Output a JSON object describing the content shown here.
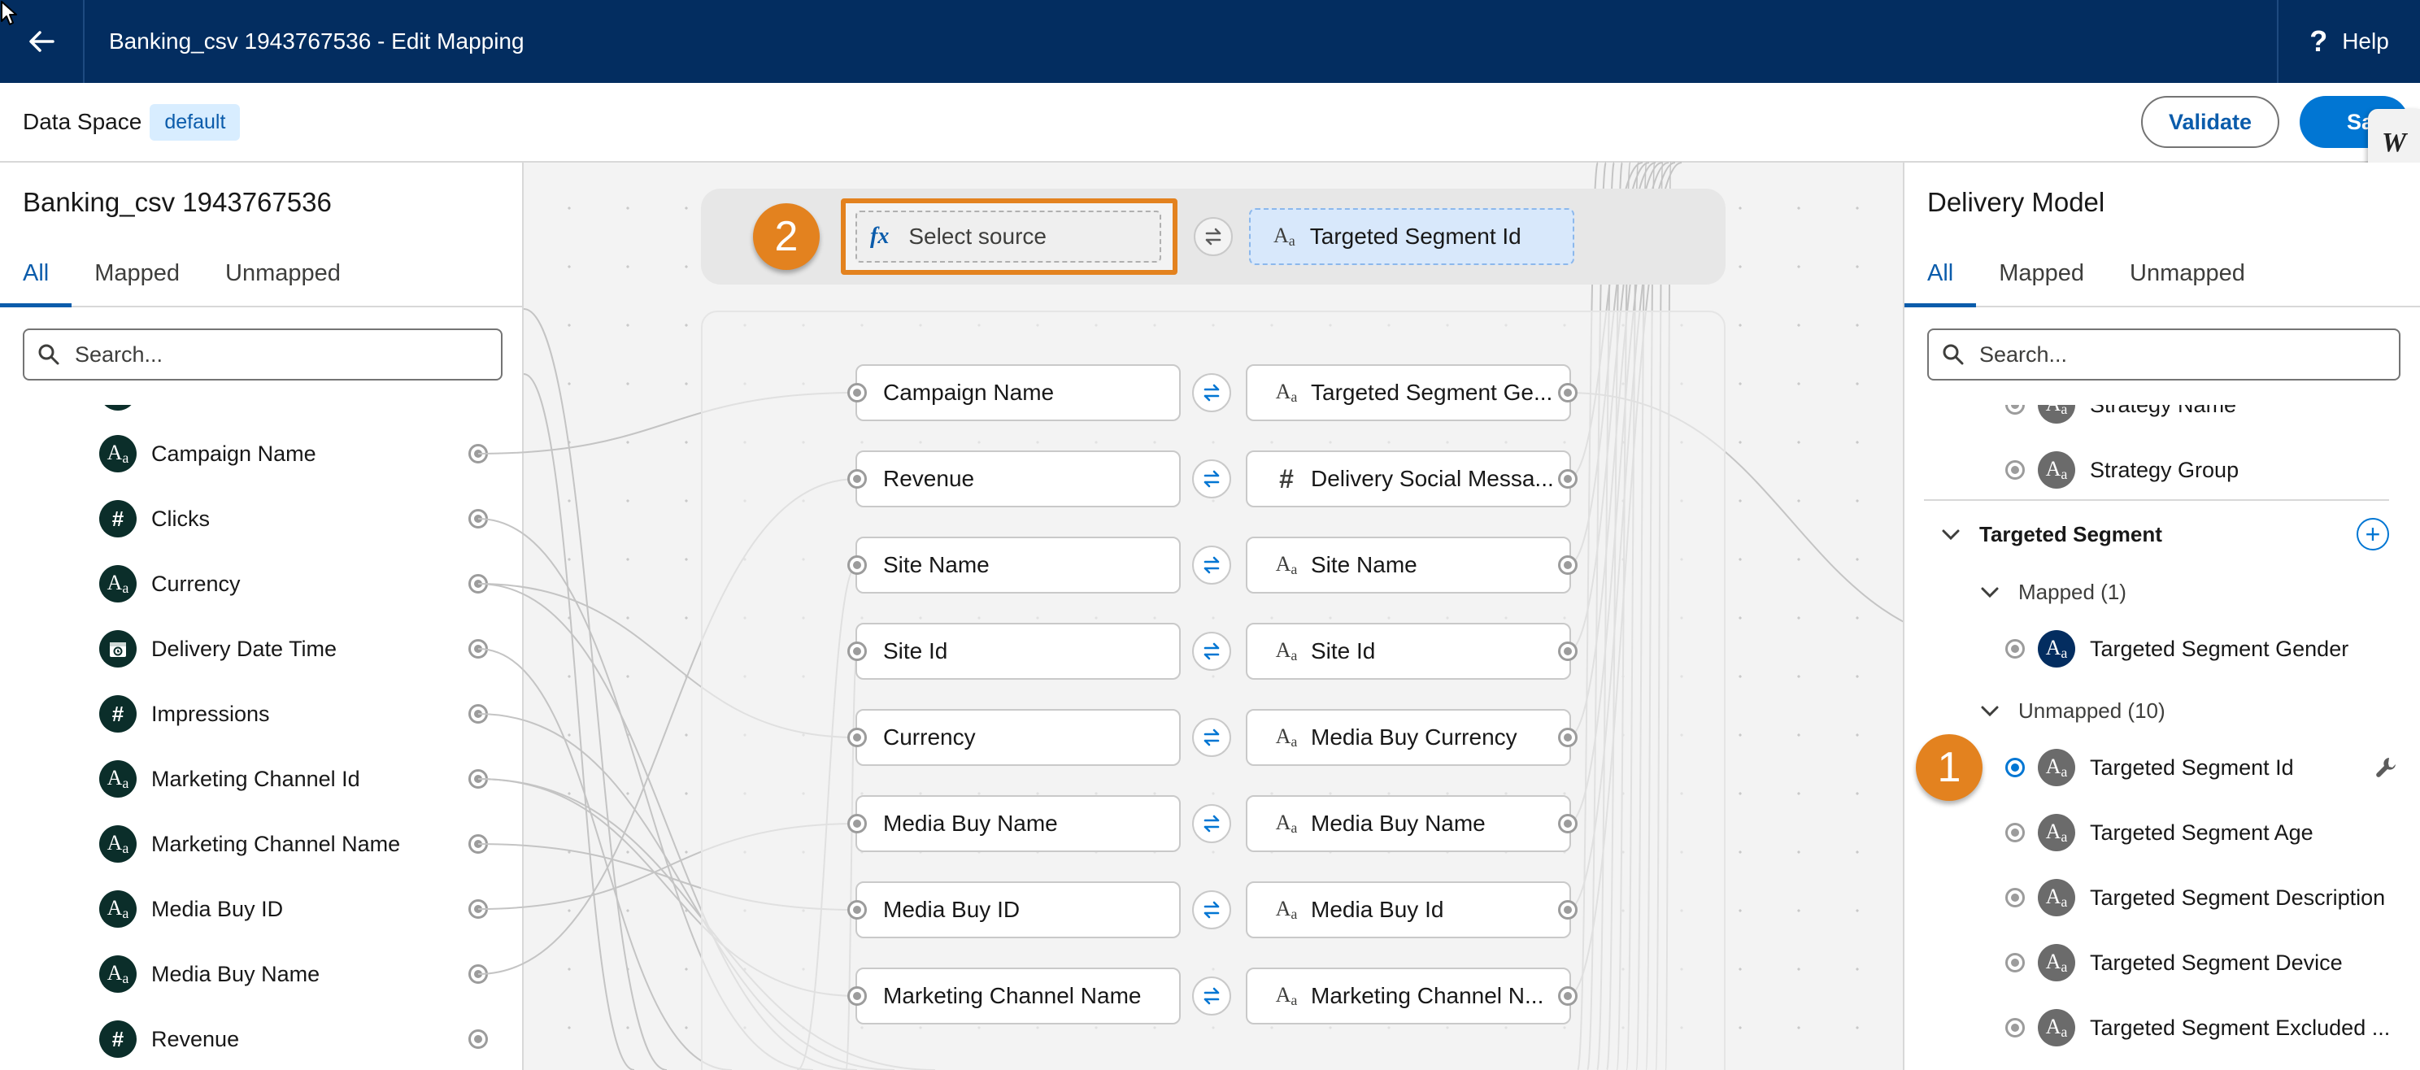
{
  "header": {
    "title": "Banking_csv 1943767536 - Edit Mapping",
    "help_label": "Help"
  },
  "subheader": {
    "data_space_label": "Data Space",
    "data_space_value": "default",
    "validate_label": "Validate",
    "save_label": "Save",
    "widget_glyph": "W"
  },
  "left_panel": {
    "title": "Banking_csv 1943767536",
    "tabs": [
      "All",
      "Mapped",
      "Unmapped"
    ],
    "search_placeholder": "Search...",
    "fields": [
      {
        "label": "Campaign Name",
        "type": "text"
      },
      {
        "label": "Clicks",
        "type": "number"
      },
      {
        "label": "Currency",
        "type": "text"
      },
      {
        "label": "Delivery Date Time",
        "type": "datetime"
      },
      {
        "label": "Impressions",
        "type": "number"
      },
      {
        "label": "Marketing Channel Id",
        "type": "text"
      },
      {
        "label": "Marketing Channel Name",
        "type": "text"
      },
      {
        "label": "Media Buy ID",
        "type": "text"
      },
      {
        "label": "Media Buy Name",
        "type": "text"
      },
      {
        "label": "Revenue",
        "type": "number"
      }
    ]
  },
  "canvas": {
    "select_source_placeholder": "Select source",
    "fx_glyph": "fx",
    "selected_target": "Targeted Segment Id",
    "mappings": [
      {
        "source": "Campaign Name",
        "target": "Targeted Segment Ge...",
        "target_type": "text"
      },
      {
        "source": "Revenue",
        "target": "Delivery Social Messa...",
        "target_type": "number"
      },
      {
        "source": "Site Name",
        "target": "Site Name",
        "target_type": "text"
      },
      {
        "source": "Site Id",
        "target": "Site Id",
        "target_type": "text"
      },
      {
        "source": "Currency",
        "target": "Media Buy Currency",
        "target_type": "text"
      },
      {
        "source": "Media Buy Name",
        "target": "Media Buy Name",
        "target_type": "text"
      },
      {
        "source": "Media Buy ID",
        "target": "Media Buy Id",
        "target_type": "text"
      },
      {
        "source": "Marketing Channel Name",
        "target": "Marketing Channel N...",
        "target_type": "text"
      }
    ]
  },
  "right_panel": {
    "title": "Delivery Model",
    "tabs": [
      "All",
      "Mapped",
      "Unmapped"
    ],
    "search_placeholder": "Search...",
    "pre_fields": [
      "Strategy Name",
      "Strategy Group"
    ],
    "group_title": "Targeted Segment",
    "mapped_label": "Mapped (1)",
    "mapped_fields": [
      "Targeted Segment Gender"
    ],
    "unmapped_label": "Unmapped (10)",
    "unmapped_fields": [
      "Targeted Segment Id",
      "Targeted Segment Age",
      "Targeted Segment Description",
      "Targeted Segment Device",
      "Targeted Segment Excluded ..."
    ]
  },
  "callouts": {
    "one": "1",
    "two": "2"
  },
  "colors": {
    "header_bg": "#032d60",
    "brand_blue": "#0176d3",
    "callout_orange": "#e3821f"
  }
}
